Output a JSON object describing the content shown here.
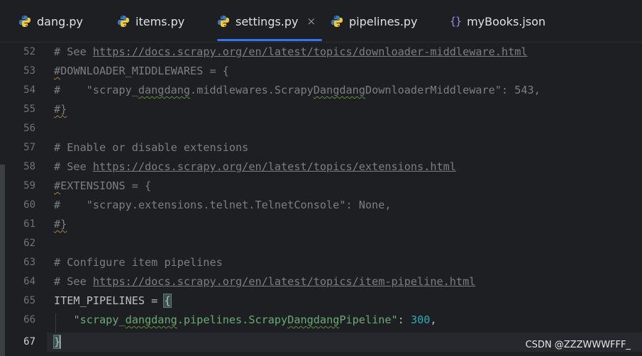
{
  "tabs": [
    {
      "label": "dang.py",
      "icon": "python-file-icon",
      "active": false
    },
    {
      "label": "items.py",
      "icon": "python-file-icon",
      "active": false
    },
    {
      "label": "settings.py",
      "icon": "python-file-icon",
      "active": true,
      "close": "×"
    },
    {
      "label": "pipelines.py",
      "icon": "python-file-icon",
      "active": false
    },
    {
      "label": "myBooks.json",
      "icon": "json-file-icon",
      "icon_text": "{}",
      "active": false
    }
  ],
  "line_numbers": [
    "52",
    "53",
    "54",
    "55",
    "56",
    "57",
    "58",
    "59",
    "60",
    "61",
    "62",
    "63",
    "64",
    "65",
    "66",
    "67"
  ],
  "current_line": "67",
  "code": {
    "l52": {
      "prefix": "# See ",
      "url": "https://docs.scrapy.org/en/latest/topics/downloader-middleware.html"
    },
    "l53": {
      "hash": "#",
      "text": "DOWNLOADER_MIDDLEWARES = {"
    },
    "l54": {
      "a": "#    \"scrapy_",
      "b": "dangdang",
      "c": ".middlewares.Scrapy",
      "d": "Dangdang",
      "e": "DownloaderMiddleware\": 543,"
    },
    "l55": {
      "text": "#}"
    },
    "l57": {
      "text": "# Enable or disable extensions"
    },
    "l58": {
      "prefix": "# See ",
      "url": "https://docs.scrapy.org/en/latest/topics/extensions.html"
    },
    "l59": {
      "hash": "#",
      "text": "EXTENSIONS = {"
    },
    "l60": {
      "text": "#    \"scrapy.extensions.telnet.TelnetConsole\": None,"
    },
    "l61": {
      "text": "#}"
    },
    "l63": {
      "text": "# Configure item pipelines"
    },
    "l64": {
      "prefix": "# See ",
      "url": "https://docs.scrapy.org/en/latest/topics/item-pipeline.html"
    },
    "l65": {
      "name": "ITEM_PIPELINES = ",
      "brace": "{"
    },
    "l66": {
      "indent": "   ",
      "q1": "\"scrapy_",
      "w1": "dangdang",
      "mid": ".pipelines.Scrapy",
      "w2": "Dangdang",
      "end": "Pipeline\"",
      "colon": ": ",
      "num": "300",
      "comma": ","
    },
    "l67": {
      "brace": "}"
    }
  },
  "watermark": "CSDN @ZZZWWWFFF_",
  "colors": {
    "background": "#1e1f22",
    "active_tab_underline": "#3574f0",
    "comment": "#7a7e85",
    "string": "#6aab73",
    "number": "#2aacb8",
    "text": "#bcbec4"
  }
}
